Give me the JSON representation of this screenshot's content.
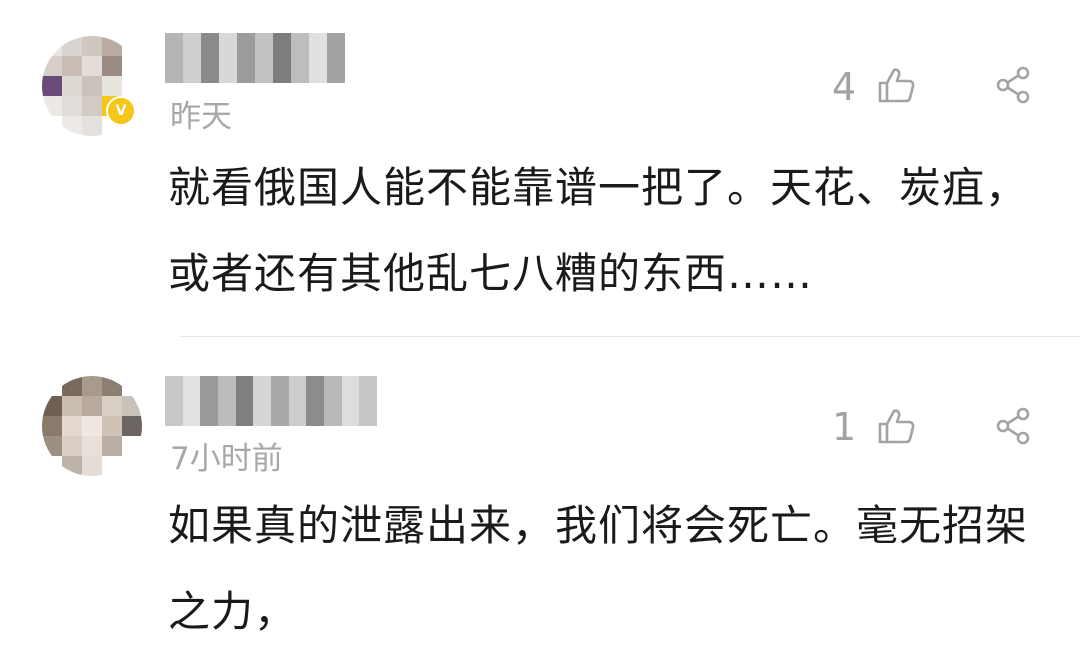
{
  "comments": [
    {
      "time": "昨天",
      "likes": "4",
      "text": "就看俄国人能不能靠谱一把了。天花、炭疽，或者还有其他乱七八糟的东西……",
      "badge": "V",
      "avatar_colors": [
        "#e9e6e3",
        "#d9d4cf",
        "#cfc8c1",
        "#b9aca3",
        "#ffffff",
        "#d6cfc8",
        "#c8beb5",
        "#e2ddd8",
        "#9a8b83",
        "#ffffff",
        "#6a4a7a",
        "#ddd8d2",
        "#cbc3bb",
        "#e7e3df",
        "#ffffff",
        "#ece9e5",
        "#e0dcd7",
        "#d2cbc4",
        "#f5c518",
        "#ffffff",
        "#ffffff",
        "#ece9e6",
        "#e4e0dc",
        "#ffffff",
        "#ffffff"
      ],
      "username_colors": [
        "#b5b5b5",
        "#cfcfcf",
        "#8a8a8a",
        "#d8d8d8",
        "#9c9c9c",
        "#c2c2c2",
        "#7d7d7d",
        "#bdbdbd",
        "#e0e0e0",
        "#a3a3a3"
      ]
    },
    {
      "time": "7小时前",
      "likes": "1",
      "text": "如果真的泄露出来，我们将会死亡。毫无招架之力，",
      "avatar_colors": [
        "#ffffff",
        "#7a6a5c",
        "#a89a8c",
        "#8d7f72",
        "#ffffff",
        "#6e5f52",
        "#c9bdb1",
        "#b7a99b",
        "#d8cec4",
        "#c9c2bb",
        "#8a7a6b",
        "#e3d9cf",
        "#efe7e0",
        "#cfc3b8",
        "#6b6460",
        "#9c8e81",
        "#d9cfc6",
        "#e8e0d8",
        "#b8aea5",
        "#ffffff",
        "#ffffff",
        "#bdb3a9",
        "#e5ddd5",
        "#ffffff",
        "#ffffff"
      ],
      "username_colors": [
        "#c8c8c8",
        "#e2e2e2",
        "#9a9a9a",
        "#bcbcbc",
        "#7f7f7f",
        "#d6d6d6",
        "#a9a9a9",
        "#cccccc",
        "#8c8c8c",
        "#b9b9b9",
        "#dddddd",
        "#c6c6c6"
      ]
    }
  ],
  "icons": {
    "like": "thumbs-up-outline-icon",
    "share": "share-icon"
  },
  "colors": {
    "muted_text": "#a8a8a8",
    "body_text": "#1a1a1a",
    "divider": "#e6e6e6"
  }
}
